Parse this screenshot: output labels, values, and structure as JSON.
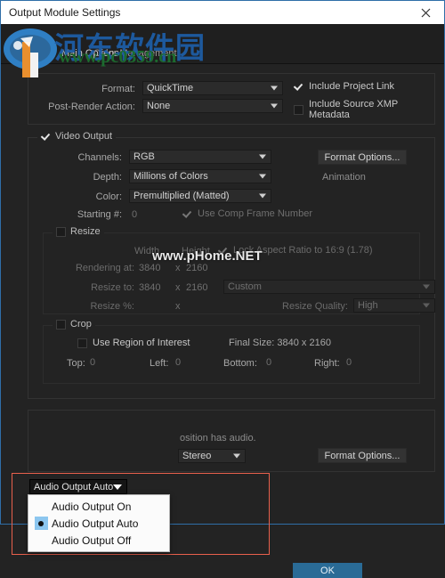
{
  "window": {
    "title": "Output Module Settings",
    "close_icon": "close-icon"
  },
  "tabs": [
    {
      "label": "Main Options",
      "active": true
    },
    {
      "label": "Color Management",
      "active": false
    }
  ],
  "format_section": {
    "format_label": "Format:",
    "format_value": "QuickTime",
    "post_render_label": "Post-Render Action:",
    "post_render_value": "None",
    "include_project_link": {
      "label": "Include Project Link",
      "checked": true
    },
    "include_xmp": {
      "label": "Include Source XMP Metadata",
      "checked": false
    }
  },
  "video_output": {
    "legend": "Video Output",
    "checked": true,
    "channels_label": "Channels:",
    "channels_value": "RGB",
    "depth_label": "Depth:",
    "depth_value": "Millions of Colors",
    "color_label": "Color:",
    "color_value": "Premultiplied (Matted)",
    "starting_label": "Starting #:",
    "starting_value": "0",
    "use_comp_frame_number": {
      "label": "Use Comp Frame Number",
      "checked": true
    },
    "format_options_button": "Format Options...",
    "codec_name": "Animation"
  },
  "resize": {
    "legend": "Resize",
    "checked": false,
    "width_header": "Width",
    "height_header": "Height",
    "lock_aspect_label": "Lock Aspect Ratio to 16:9 (1.78)",
    "lock_aspect_checked": true,
    "rendering_at_label": "Rendering at:",
    "rendering_width": "3840",
    "rendering_x": "x",
    "rendering_height": "2160",
    "resize_to_label": "Resize to:",
    "resize_width": "3840",
    "resize_x": "x",
    "resize_height": "2160",
    "preset_value": "Custom",
    "resize_pct_label": "Resize %:",
    "resize_pct_x": "x",
    "quality_label": "Resize Quality:",
    "quality_value": "High"
  },
  "crop": {
    "legend": "Crop",
    "checked": false,
    "use_roi": {
      "label": "Use Region of Interest",
      "checked": false
    },
    "final_size": "Final Size: 3840 x 2160",
    "top_label": "Top:",
    "top_value": "0",
    "left_label": "Left:",
    "left_value": "0",
    "bottom_label": "Bottom:",
    "bottom_value": "0",
    "right_label": "Right:",
    "right_value": "0"
  },
  "audio_output": {
    "current_value": "Audio Output Auto",
    "menu_options": [
      {
        "label": "Audio Output On",
        "selected": false
      },
      {
        "label": "Audio Output Auto",
        "selected": true
      },
      {
        "label": "Audio Output Off",
        "selected": false
      }
    ],
    "note_text": "osition has audio.",
    "channels_value": "Stereo",
    "format_options_button": "Format Options..."
  },
  "footer": {
    "ok_label": "OK"
  },
  "watermark": {
    "chinese": "河东软件园",
    "url": "www.pc0359.cn",
    "secondary": "www.pHome.NET"
  },
  "colors": {
    "accent_blue": "#2a6b96",
    "highlight_red": "#e8604c",
    "titlebar": "#ffffff",
    "panel_bg": "#232323",
    "radio_blue": "#8cc6ef"
  }
}
